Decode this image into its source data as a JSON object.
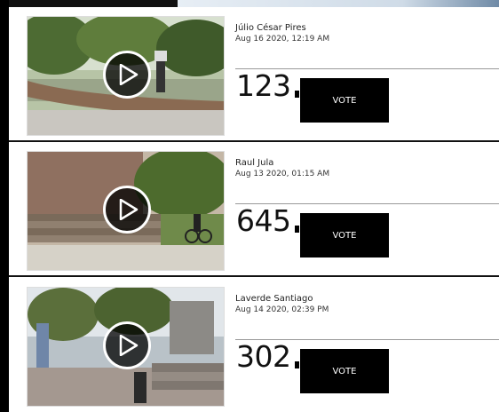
{
  "videos": [
    {
      "author": "Júlio César Pires",
      "date": "Aug 16 2020, 12:19 AM",
      "votes": "123",
      "vote_label": "VOTE"
    },
    {
      "author": "Raul Jula",
      "date": "Aug 13 2020, 01:15 AM",
      "votes": "645",
      "vote_label": "VOTE"
    },
    {
      "author": "Laverde Santiago",
      "date": "Aug 14 2020, 02:39 PM",
      "votes": "302",
      "vote_label": "VOTE"
    }
  ],
  "icons": {
    "play": "play-icon"
  },
  "colors": {
    "vote_button": "#000000",
    "divider": "#111111",
    "page": "#ffffff"
  }
}
